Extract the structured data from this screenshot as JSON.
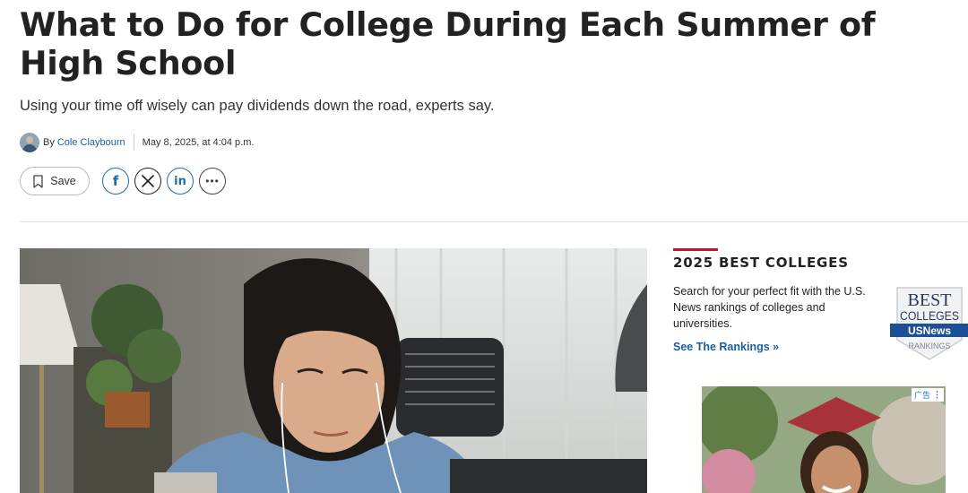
{
  "article": {
    "headline": "What to Do for College During Each Summer of High School",
    "subheadline": "Using your time off wisely can pay dividends down the road, experts say.",
    "byline_prefix": "By",
    "author": "Cole Claybourn",
    "date": "May 8, 2025, at 4:04 p.m."
  },
  "actions": {
    "save_label": "Save",
    "share": [
      {
        "name": "facebook-icon",
        "glyph": "f"
      },
      {
        "name": "x-icon",
        "glyph": "X"
      },
      {
        "name": "linkedin-icon",
        "glyph": "in"
      },
      {
        "name": "more-icon",
        "glyph": "•••"
      }
    ]
  },
  "sidebar": {
    "title": "2025 BEST COLLEGES",
    "description": "Search for your perfect fit with the U.S. News rankings of colleges and universities.",
    "link": "See The Rankings »",
    "badge": {
      "line1": "BEST",
      "line2": "COLLEGES",
      "line3": "USNews",
      "line4": "RANKINGS"
    }
  },
  "ad": {
    "label": "广告"
  },
  "colors": {
    "accent": "#c8102e",
    "link": "#1a5ea8",
    "brand_blue": "#1d6dab"
  }
}
